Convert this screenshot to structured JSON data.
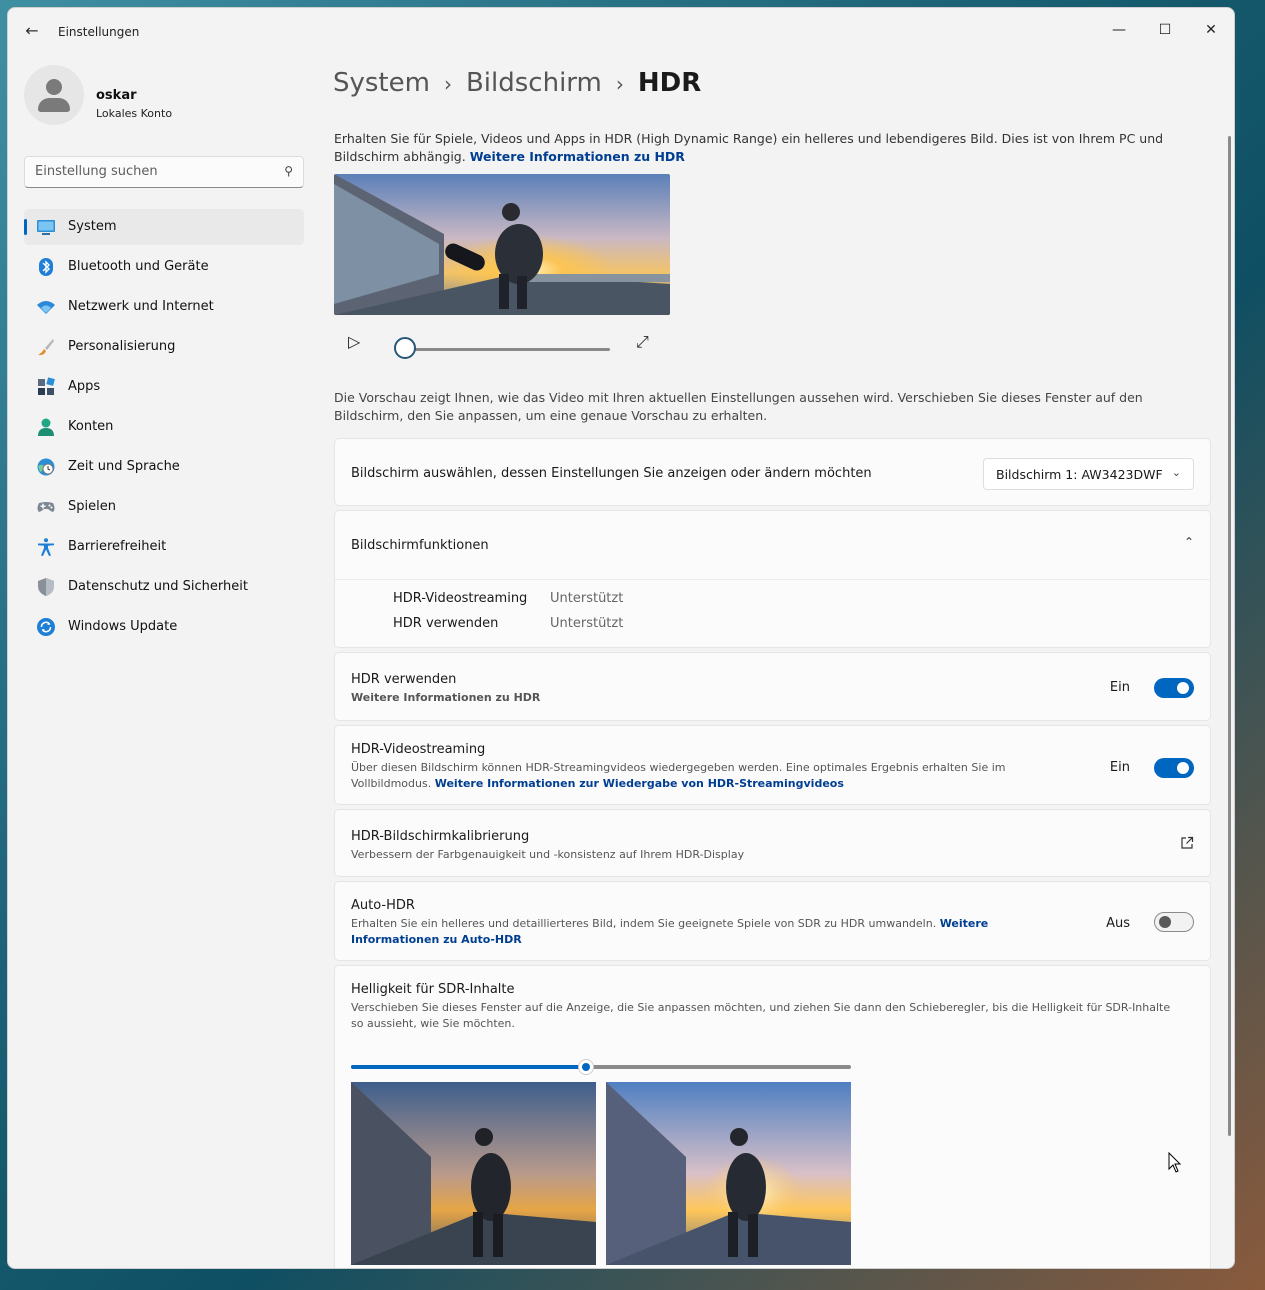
{
  "window": {
    "title": "Einstellungen",
    "controls": {
      "minimize": "—",
      "maximize": "☐",
      "close": "✕"
    }
  },
  "profile": {
    "name": "oskar",
    "account": "Lokales Konto"
  },
  "search": {
    "placeholder": "Einstellung suchen",
    "icon": "search-icon"
  },
  "nav": [
    {
      "label": "System",
      "icon": "system-icon",
      "active": true
    },
    {
      "label": "Bluetooth und Geräte",
      "icon": "bluetooth-icon"
    },
    {
      "label": "Netzwerk und Internet",
      "icon": "wifi-icon"
    },
    {
      "label": "Personalisierung",
      "icon": "brush-icon"
    },
    {
      "label": "Apps",
      "icon": "apps-icon"
    },
    {
      "label": "Konten",
      "icon": "account-icon"
    },
    {
      "label": "Zeit und Sprache",
      "icon": "clock-globe-icon"
    },
    {
      "label": "Spielen",
      "icon": "gamepad-icon"
    },
    {
      "label": "Barrierefreiheit",
      "icon": "accessibility-icon"
    },
    {
      "label": "Datenschutz und Sicherheit",
      "icon": "shield-icon"
    },
    {
      "label": "Windows Update",
      "icon": "update-icon"
    }
  ],
  "breadcrumb": {
    "part1": "System",
    "part2": "Bildschirm",
    "current": "HDR",
    "separator": "›"
  },
  "intro": {
    "text": "Erhalten Sie für Spiele, Videos und Apps in HDR (High Dynamic Range) ein helleres und lebendigeres Bild. Dies ist von Ihrem PC und Bildschirm abhängig.",
    "link": "Weitere Informationen zu HDR"
  },
  "player": {
    "progress": 0
  },
  "preview_note": "Die Vorschau zeigt Ihnen, wie das Video mit Ihren aktuellen Einstellungen aussehen wird. Verschieben Sie dieses Fenster auf den Bildschirm, den Sie anpassen, um eine genaue Vorschau zu erhalten.",
  "display_select": {
    "label": "Bildschirm auswählen, dessen Einstellungen Sie anzeigen oder ändern möchten",
    "value": "Bildschirm 1: AW3423DWF"
  },
  "capabilities": {
    "title": "Bildschirmfunktionen",
    "rows": [
      {
        "name": "HDR-Videostreaming",
        "value": "Unterstützt"
      },
      {
        "name": "HDR verwenden",
        "value": "Unterstützt"
      }
    ]
  },
  "use_hdr": {
    "title": "HDR verwenden",
    "link": "Weitere Informationen zu HDR",
    "state": "Ein",
    "on": true
  },
  "hdr_streaming": {
    "title": "HDR-Videostreaming",
    "desc": "Über diesen Bildschirm können HDR-Streamingvideos wiedergegeben werden. Eine optimales Ergebnis erhalten Sie im Vollbildmodus.",
    "link": "Weitere Informationen zur Wiedergabe von HDR-Streamingvideos",
    "state": "Ein",
    "on": true
  },
  "calibration": {
    "title": "HDR-Bildschirmkalibrierung",
    "desc": "Verbessern der Farbgenauigkeit und -konsistenz auf Ihrem HDR-Display"
  },
  "auto_hdr": {
    "title": "Auto-HDR",
    "desc": "Erhalten Sie ein helleres und detaillierteres Bild, indem Sie geeignete Spiele von SDR zu HDR umwandeln.",
    "link": "Weitere Informationen zu Auto-HDR",
    "state": "Aus",
    "on": false
  },
  "sdr_brightness": {
    "title": "Helligkeit für SDR-Inhalte",
    "desc": "Verschieben Sie dieses Fenster auf die Anzeige, die Sie anpassen möchten, und ziehen Sie dann den Schieberegler, bis die Helligkeit für SDR-Inhalte so aussieht, wie Sie möchten.",
    "slider_value": 0.47
  },
  "colors": {
    "accent": "#0067c0",
    "link": "#003e92"
  }
}
